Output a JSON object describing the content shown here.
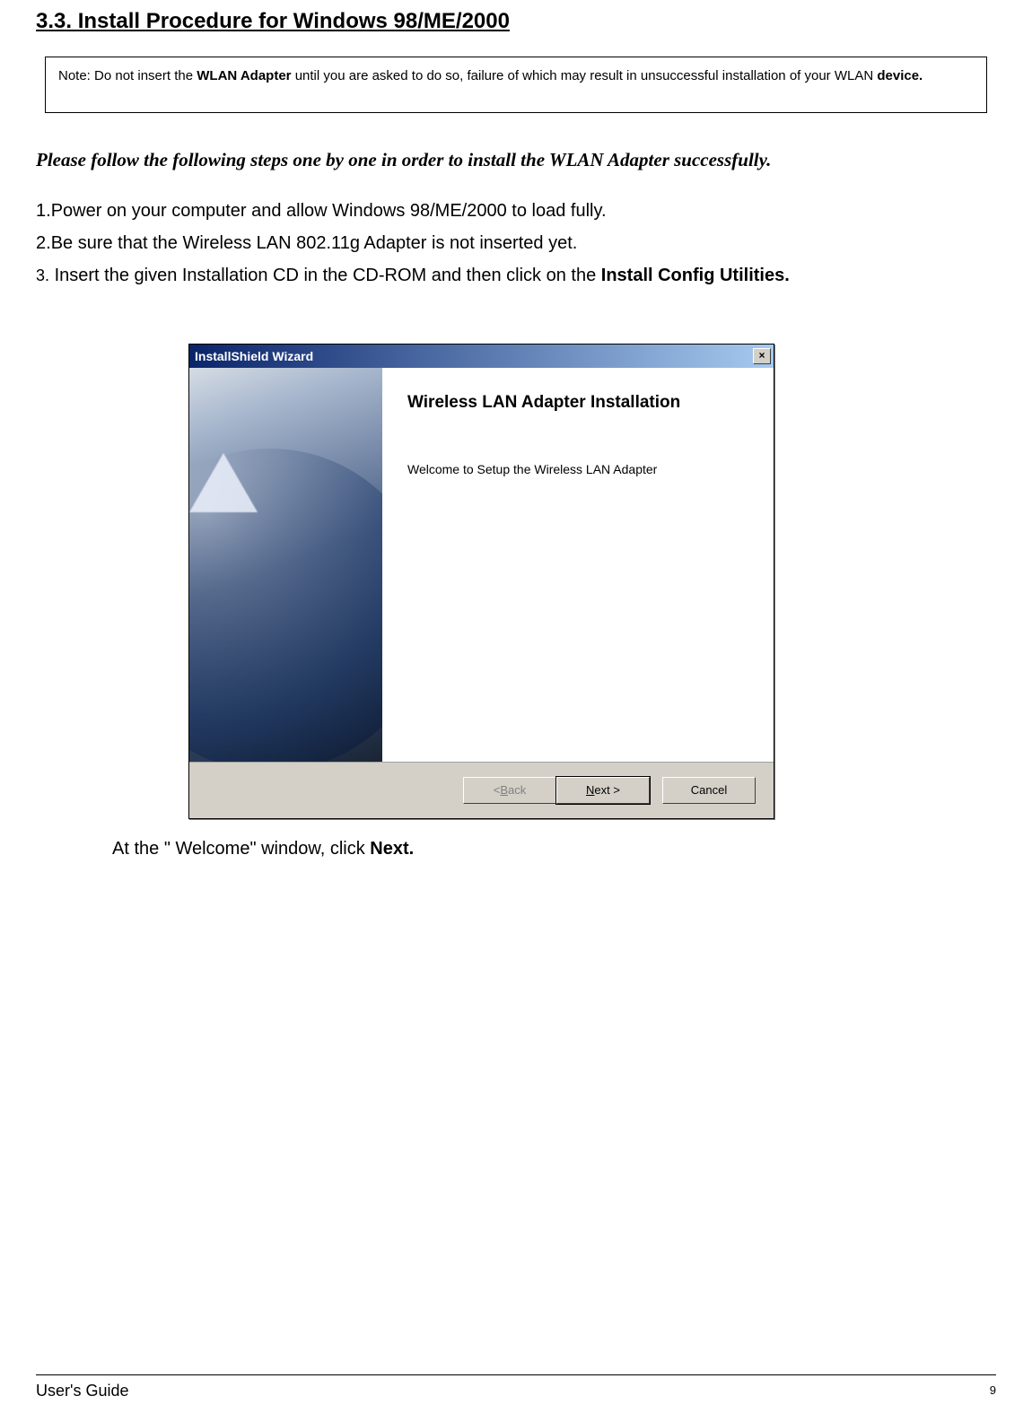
{
  "heading": "3.3. Install Procedure for Windows 98/ME/2000",
  "note": {
    "prefix": "Note: Do not insert the ",
    "bold1": "WLAN Adapter",
    "middle": " until you are asked to do so, failure of which may result in unsuccessful installation of your WLAN ",
    "bold2": "device."
  },
  "instruction": "Please follow the following steps one by one in order to install the WLAN  Adapter successfully.",
  "steps": {
    "s1": {
      "num": "1.",
      "text": "Power on your computer and allow Windows 98/ME/2000 to load fully."
    },
    "s2": {
      "num": "2.",
      "text": "Be sure that the Wireless LAN  802.11g Adapter is not inserted yet."
    },
    "s3": {
      "num": "3.",
      "text_pre": " Insert the given Installation CD in the CD-ROM and then click on the ",
      "bold": "Install Config Utilities."
    }
  },
  "wizard": {
    "title": "InstallShield Wizard",
    "close": "×",
    "heading": "Wireless LAN Adapter Installation",
    "body_text": "Welcome to Setup the Wireless LAN Adapter",
    "buttons": {
      "back_lt": "< ",
      "back_u": "B",
      "back_rest": "ack",
      "next_u": "N",
      "next_rest": "ext >",
      "cancel": "Cancel"
    }
  },
  "caption": {
    "pre": "At the \" Welcome\" window, click ",
    "bold": "Next."
  },
  "footer": "User's Guide",
  "page": "9"
}
